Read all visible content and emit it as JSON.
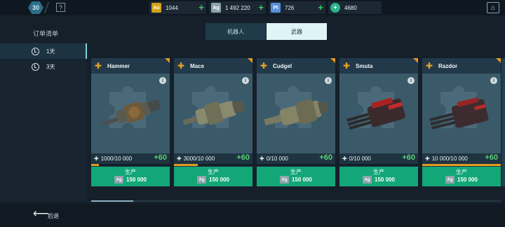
{
  "topbar": {
    "level": "30",
    "help_icon": "?",
    "menu_icon": "shop-icon",
    "currencies": [
      {
        "code": "Au",
        "value": "1044",
        "color": "#d4a21b"
      },
      {
        "code": "Ag",
        "value": "1 492 220",
        "color": "#8fa3ac"
      },
      {
        "code": "Pt",
        "value": "726",
        "color": "#5a8fd8"
      },
      {
        "code": "key",
        "value": "4680",
        "color": "#2bb489"
      }
    ]
  },
  "sidebar": {
    "title": "订单清单",
    "items": [
      {
        "label": "1天",
        "active": true
      },
      {
        "label": "3天",
        "active": false
      }
    ]
  },
  "tabs": [
    {
      "label": "机器人",
      "active": false
    },
    {
      "label": "武器",
      "active": true
    }
  ],
  "cards": [
    {
      "name": "Hammer",
      "progress": "1000/10 000",
      "progress_fraction": 0.1,
      "gain": "+60",
      "action": "生产",
      "currency": "Ag",
      "cost": "150 000"
    },
    {
      "name": "Mace",
      "progress": "3000/10 000",
      "progress_fraction": 0.3,
      "gain": "+60",
      "action": "生产",
      "currency": "Ag",
      "cost": "150 000"
    },
    {
      "name": "Cudgel",
      "progress": "0/10 000",
      "progress_fraction": 0,
      "gain": "+60",
      "action": "生产",
      "currency": "Ag",
      "cost": "150 000"
    },
    {
      "name": "Smuta",
      "progress": "0/10 000",
      "progress_fraction": 0,
      "gain": "+60",
      "action": "生产",
      "currency": "Ag",
      "cost": "150 000"
    },
    {
      "name": "Razdor",
      "progress": "10 000/10 000",
      "progress_fraction": 1.0,
      "gain": "+60",
      "action": "生产",
      "currency": "Ag",
      "cost": "150 000"
    }
  ],
  "footer": {
    "back_label": "后退"
  }
}
